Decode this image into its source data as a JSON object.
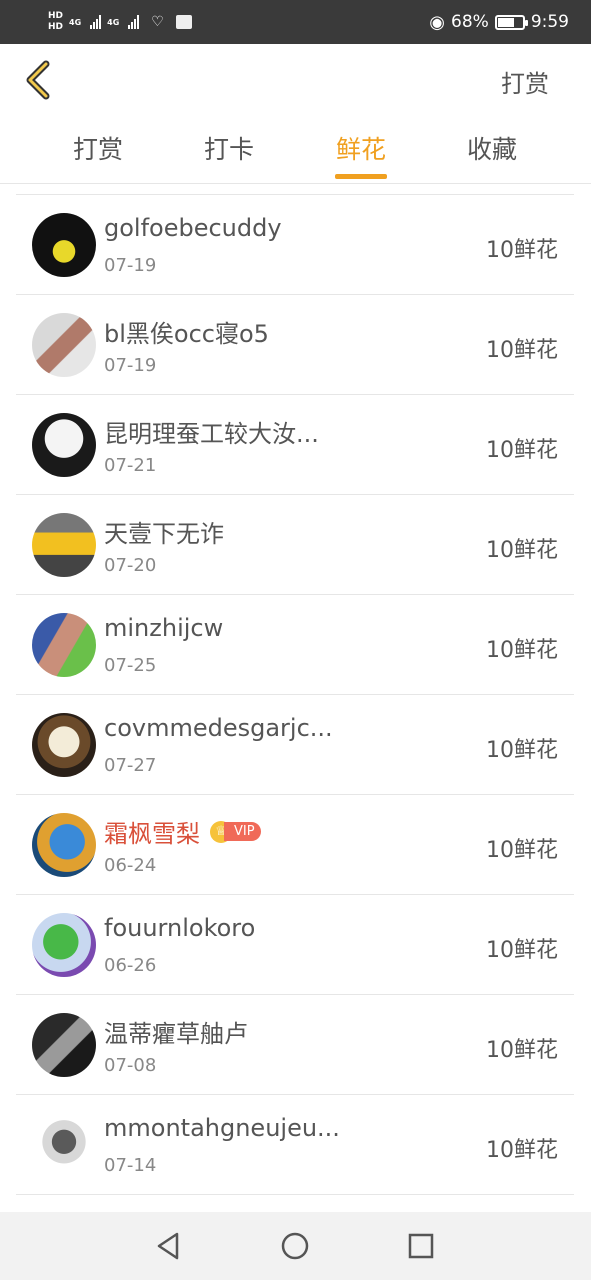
{
  "status": {
    "battery": "68%",
    "time": "9:59",
    "battery_level": 0.68
  },
  "header": {
    "back_icon": "chevron-left-icon",
    "action_label": "打赏"
  },
  "tabs": [
    {
      "label": "打赏"
    },
    {
      "label": "打卡"
    },
    {
      "label": "鲜花",
      "active": true
    },
    {
      "label": "收藏"
    }
  ],
  "rows": [
    {
      "name": "golfoebecuddy",
      "date": "07-19",
      "amount": "10鲜花"
    },
    {
      "name": "bl黑俟occ寝o5",
      "date": "07-19",
      "amount": "10鲜花"
    },
    {
      "name": "昆明理蚕工较大汝...",
      "date": "07-21",
      "amount": "10鲜花"
    },
    {
      "name": "天壹下无诈",
      "date": "07-20",
      "amount": "10鲜花"
    },
    {
      "name": "minzhijcw",
      "date": "07-25",
      "amount": "10鲜花"
    },
    {
      "name": "covmmedesgarjc...",
      "date": "07-27",
      "amount": "10鲜花"
    },
    {
      "name": "霜枫雪梨",
      "date": "06-24",
      "amount": "10鲜花",
      "vip": "VIP"
    },
    {
      "name": "fouurnlokoro",
      "date": "06-26",
      "amount": "10鲜花"
    },
    {
      "name": "温蒂癯草舳卢",
      "date": "07-08",
      "amount": "10鲜花"
    },
    {
      "name": "mmontahgneujeu...",
      "date": "07-14",
      "amount": "10鲜花"
    }
  ],
  "colors": {
    "accent": "#f0a020",
    "vip_name": "#d9503a",
    "vip_tag": "#f06a58"
  },
  "nav": {
    "back_icon": "triangle-back-icon",
    "home_icon": "circle-home-icon",
    "recents_icon": "square-recents-icon"
  }
}
